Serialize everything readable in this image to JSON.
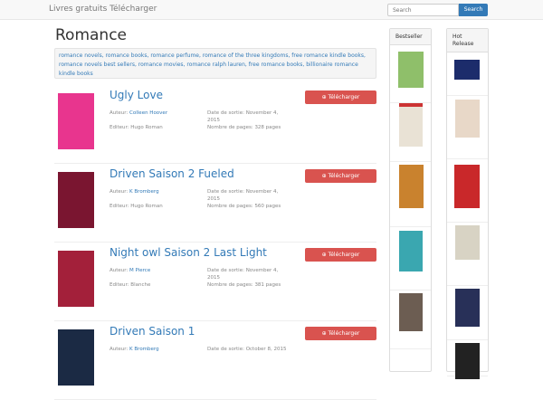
{
  "nav": {
    "brand": "Livres gratuits Télécharger",
    "search_placeholder": "Search",
    "search_button": "Search"
  },
  "page": {
    "title": "Romance",
    "tags": "romance novels, romance books, romance perfume, romance of the three kingdoms, free romance kindle books, romance novels best sellers, romance movies, romance ralph lauren, free romance books, billionaire romance kindle books"
  },
  "labels": {
    "author": "Auteur: ",
    "editor": "Editeur: ",
    "date": "Date de sortie: ",
    "pages": "Nombre de pages: ",
    "download": "⊕ Télécharger"
  },
  "books": [
    {
      "title": "Ugly Love",
      "author": "Colleen Hoover",
      "editor": "Hugo Roman",
      "date": "November 4, 2015",
      "pages": "328 pages",
      "color": "#e8358e"
    },
    {
      "title": "Driven Saison 2 Fueled",
      "author": "K Bromberg",
      "editor": "Hugo Roman",
      "date": "November 4, 2015",
      "pages": "560 pages",
      "color": "#7a1530"
    },
    {
      "title": "Night owl Saison 2 Last Light",
      "author": "M Pierce",
      "editor": "Blanche",
      "date": "November 4, 2015",
      "pages": "381 pages",
      "color": "#a3203a"
    },
    {
      "title": "Driven Saison 1",
      "author": "K Bromberg",
      "editor": "",
      "date": "October 8, 2015",
      "pages": "",
      "color": "#1b2a44"
    }
  ],
  "sidebar": {
    "bestseller": "Bestseller",
    "hot": "Hot Release"
  }
}
